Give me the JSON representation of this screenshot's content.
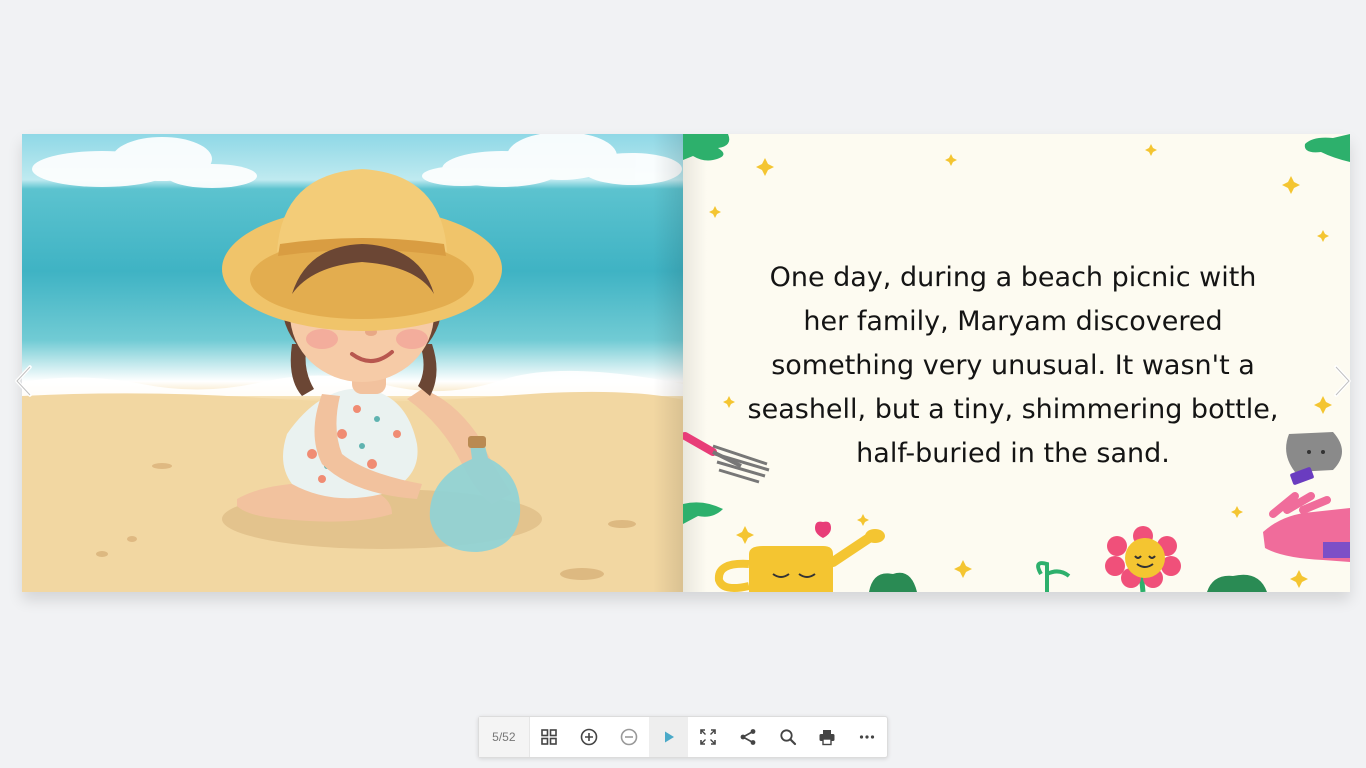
{
  "book": {
    "story_text": "One day, during a beach picnic with her family, Maryam discovered something very unusual. It wasn't a seashell, but a tiny, shimmering bottle, half-buried in the sand."
  },
  "toolbar": {
    "page_counter": "5/52",
    "accent_color": "#4aa9c8",
    "buttons": [
      {
        "name": "thumbnails",
        "icon": "grid-icon"
      },
      {
        "name": "zoom-in",
        "icon": "zoom-in-icon"
      },
      {
        "name": "zoom-out",
        "icon": "zoom-out-icon"
      },
      {
        "name": "autoplay",
        "icon": "play-icon"
      },
      {
        "name": "fullscreen",
        "icon": "fullscreen-icon"
      },
      {
        "name": "share",
        "icon": "share-icon"
      },
      {
        "name": "search",
        "icon": "search-icon"
      },
      {
        "name": "print",
        "icon": "print-icon"
      },
      {
        "name": "more",
        "icon": "more-icon"
      }
    ]
  },
  "navigation": {
    "prev_icon": "chevron-left-icon",
    "next_icon": "chevron-right-icon"
  }
}
